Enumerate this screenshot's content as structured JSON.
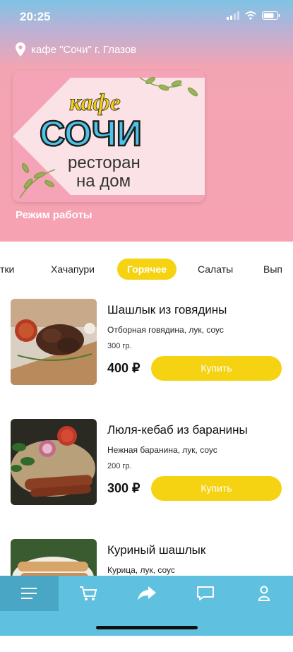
{
  "status_bar": {
    "time": "20:25"
  },
  "header": {
    "location": "кафе \"Сочи\" г. Глазов",
    "banner": {
      "logo_script": "кафе",
      "logo_main": "СОЧИ",
      "tagline_line1": "ресторан",
      "tagline_line2": "на дом"
    },
    "hours_link": "Режим работы"
  },
  "tabs": [
    {
      "label": "тки"
    },
    {
      "label": "Хачапури"
    },
    {
      "label": "Горячее"
    },
    {
      "label": "Салаты"
    },
    {
      "label": "Вып"
    }
  ],
  "active_tab": "Горячее",
  "products": [
    {
      "name": "Шашлык из говядины",
      "description": "Отборная говядина, лук, соус",
      "weight": "300 гр.",
      "price": "400 ₽",
      "button": "Купить"
    },
    {
      "name": "Люля-кебаб из баранины",
      "description": "Нежная баранина, лук, соус",
      "weight": "200 гр.",
      "price": "300 ₽",
      "button": "Купить"
    },
    {
      "name": "Куриный шашлык",
      "description": "Курица, лук, соус"
    }
  ],
  "bottom_nav": [
    {
      "icon": "menu-icon"
    },
    {
      "icon": "cart-icon"
    },
    {
      "icon": "share-icon"
    },
    {
      "icon": "chat-icon"
    },
    {
      "icon": "profile-icon"
    }
  ],
  "colors": {
    "accent": "#f5d312",
    "header_pink": "#f6a2b2",
    "nav_blue": "#5fc1df"
  }
}
